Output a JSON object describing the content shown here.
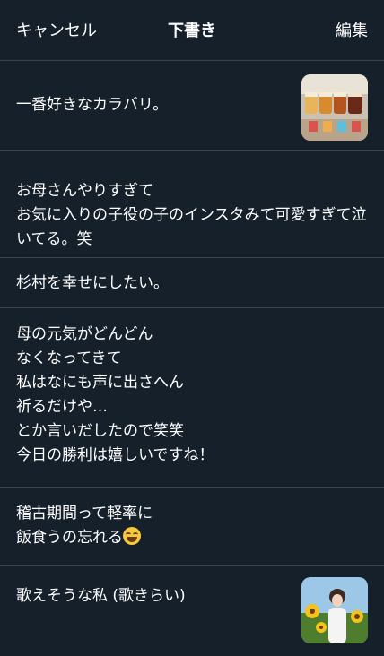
{
  "header": {
    "cancel_label": "キャンセル",
    "title": "下書き",
    "edit_label": "編集"
  },
  "drafts": [
    {
      "text": "一番好きなカラバリ。",
      "has_image": true,
      "image_icon": "beer-glasses-photo"
    },
    {
      "text": "お母さんやりすぎて\nお気に入りの子役の子のインスタみて可愛すぎて泣いてる。笑"
    },
    {
      "text": "杉村を幸せにしたい。"
    },
    {
      "text": "母の元気がどんどん\nなくなってきて\n私はなにも声に出さへん\n祈るだけや…\nとか言いだしたので笑笑\n今日の勝利は嬉しいですね！"
    },
    {
      "text_line1": "稽古期間って軽率に",
      "text_line2": "飯食うの忘れる",
      "emoji_icon": "face-with-tears-of-joy"
    },
    {
      "text": "歌えそうな私 (歌きらい)",
      "has_image": true,
      "image_icon": "sunflower-portrait-photo"
    }
  ],
  "colors": {
    "background": "#15202b",
    "divider": "#38444d",
    "text": "#ffffff"
  }
}
